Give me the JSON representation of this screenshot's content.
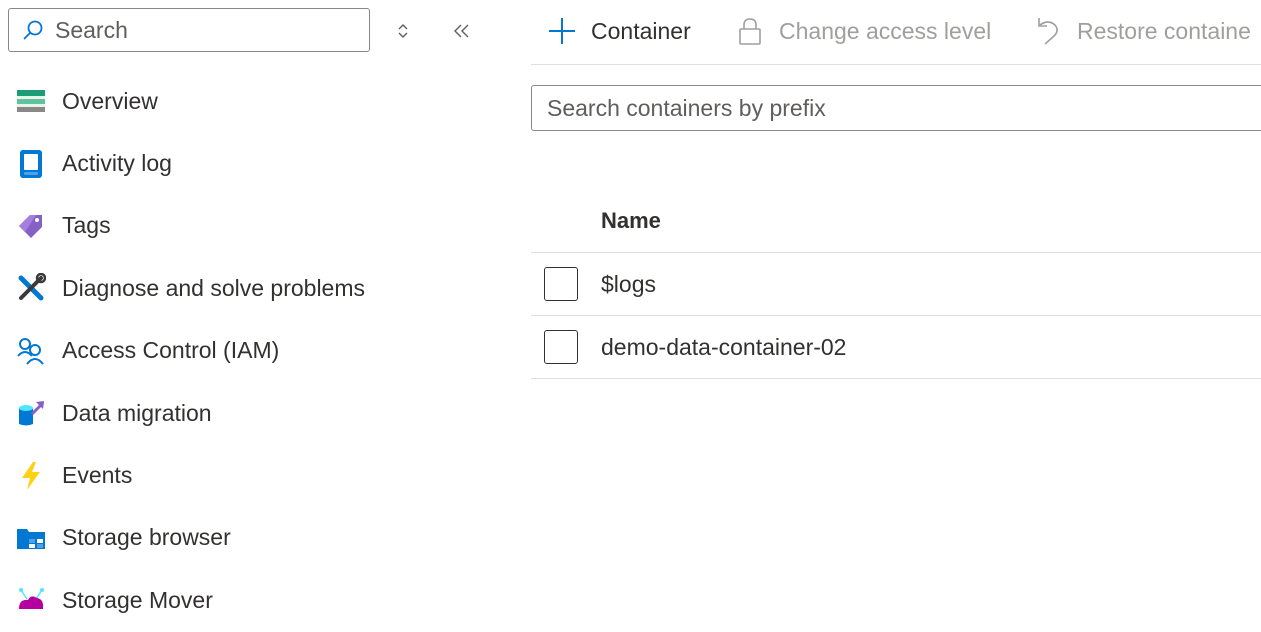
{
  "leftnav": {
    "search": {
      "placeholder": "Search"
    },
    "items": [
      {
        "label": "Overview"
      },
      {
        "label": "Activity log"
      },
      {
        "label": "Tags"
      },
      {
        "label": "Diagnose and solve problems"
      },
      {
        "label": "Access Control (IAM)"
      },
      {
        "label": "Data migration"
      },
      {
        "label": "Events"
      },
      {
        "label": "Storage browser"
      },
      {
        "label": "Storage Mover"
      }
    ]
  },
  "toolbar": {
    "add_container_label": "Container",
    "change_access_label": "Change access level",
    "restore_label": "Restore containe"
  },
  "filter": {
    "placeholder": "Search containers by prefix"
  },
  "grid": {
    "columns": [
      {
        "label": "Name"
      }
    ],
    "rows": [
      {
        "name": "$logs"
      },
      {
        "name": "demo-data-container-02"
      }
    ]
  },
  "colors": {
    "accent": "#0078d4",
    "border": "#8a8886",
    "divider": "#e1dfdd",
    "text": "#323130",
    "disabled_text": "#a19f9d"
  }
}
